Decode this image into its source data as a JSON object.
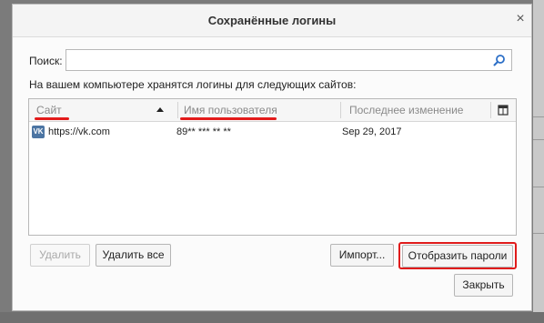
{
  "dialog": {
    "title": "Сохранённые логины",
    "close_glyph": "×"
  },
  "search": {
    "label": "Поиск:",
    "value": "",
    "placeholder": ""
  },
  "info_text": "На вашем компьютере хранятся логины для следующих сайтов:",
  "table": {
    "columns": [
      "Сайт",
      "Имя пользователя",
      "Последнее изменение"
    ],
    "sorted_column": "Сайт",
    "sort_direction": "ascending",
    "rows": [
      {
        "icon": "vk-icon",
        "icon_text": "VK",
        "site": "https://vk.com",
        "username": "89** *** ** **",
        "modified": "Sep 29, 2017"
      }
    ]
  },
  "buttons": {
    "remove": "Удалить",
    "remove_all": "Удалить все",
    "import": "Импорт...",
    "show_passwords": "Отобразить пароли",
    "close": "Закрыть"
  },
  "colors": {
    "annotation_red": "#e01b1b",
    "vk_blue": "#4c75a3"
  }
}
